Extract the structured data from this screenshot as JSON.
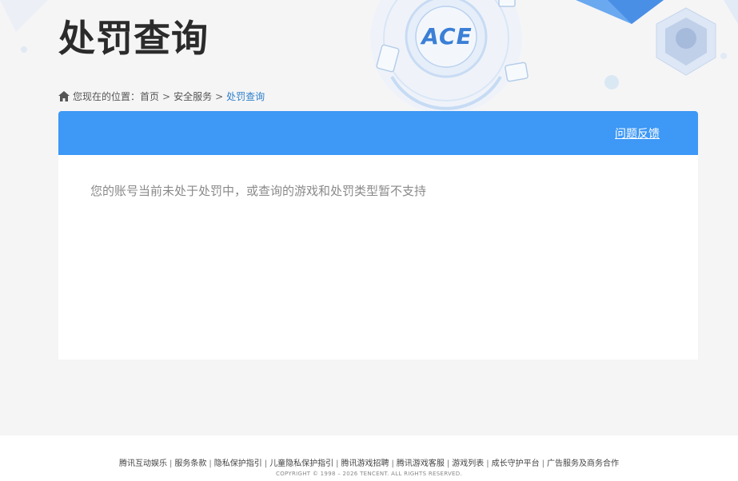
{
  "header": {
    "title": "处罚查询",
    "logo_text": "ACE"
  },
  "breadcrumb": {
    "prefix": "您现在的位置：",
    "items": [
      {
        "label": "首页"
      },
      {
        "label": "安全服务"
      }
    ],
    "current": "处罚查询",
    "separator": ">"
  },
  "panel": {
    "feedback_label": "问题反馈",
    "message": "您的账号当前未处于处罚中，或查询的游戏和处罚类型暂不支持"
  },
  "footer": {
    "links": [
      "腾讯互动娱乐",
      "服务条款",
      "隐私保护指引",
      "儿童隐私保护指引",
      "腾讯游戏招聘",
      "腾讯游戏客服",
      "游戏列表",
      "成长守护平台",
      "广告服务及商务合作"
    ],
    "link_separator": "|",
    "copyright": "COPYRIGHT © 1998 – 2026 TENCENT. ALL RIGHTS RESERVED."
  },
  "colors": {
    "header_bar": "#3d98f6",
    "breadcrumb_current": "#2e80c9",
    "page_bg": "#f5f5f6"
  }
}
